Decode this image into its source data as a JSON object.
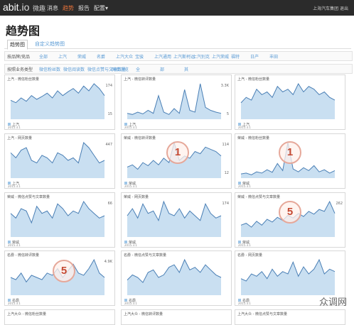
{
  "nav": {
    "logo_main": "abit",
    "logo_io": ".io",
    "logo_sub": "微趣",
    "items": [
      "消息",
      "趋势",
      "报告",
      "配置▾"
    ],
    "right": "上海汽车集团 退出",
    "active_index": 1
  },
  "page": {
    "title": "趋势图"
  },
  "tabs": [
    {
      "label": "趋势图"
    },
    {
      "label": "自定义趋势图"
    }
  ],
  "filter1": {
    "label": "按品牌/竞品",
    "options": [
      "全部",
      "上汽",
      "荣威",
      "名爵",
      "上汽大众",
      "宝骏",
      "上汽通用",
      "上汽斯柯达",
      "上汽别克",
      "上汽荣威",
      "福特",
      "日产",
      "丰田"
    ]
  },
  "filter2": {
    "label": "按照业务类型",
    "options": [
      "微信粉丝数",
      "微信阅读数",
      "微信点赞与文章数量",
      "网页浏览",
      "全",
      "部",
      "其"
    ]
  },
  "cards": [
    {
      "title": "上汽 - 微信粉丝数量",
      "ymax": "174",
      "ymin": "15",
      "legend": "上汽",
      "date": "2015.3.1"
    },
    {
      "title": "上汽 - 微信转评数量",
      "ymax": "3.3K",
      "ymin": "5",
      "legend": "上汽",
      "date": "2015.3.1"
    },
    {
      "title": "上汽 - 微信粉丝数量",
      "ymax": "",
      "ymin": "",
      "legend": "上汽",
      "date": "2015.3.1"
    },
    {
      "title": "上汽 - 网页数量",
      "ymax": "447",
      "ymin": "",
      "legend": "上汽",
      "date": "2015.3.1"
    },
    {
      "title": "荣威 - 微信转评数量",
      "ymax": "114",
      "ymin": "12",
      "legend": "荣威",
      "date": "2015.3.1"
    },
    {
      "title": "荣威 - 微信粉丝数量",
      "ymax": "",
      "ymin": "",
      "legend": "荣威",
      "date": "2015.3.1"
    },
    {
      "title": "荣威 - 微信点赞与文章数量",
      "ymax": "66",
      "ymin": "",
      "legend": "荣威",
      "date": "2015.3.1"
    },
    {
      "title": "荣威 - 网页数量",
      "ymax": "174",
      "ymin": "",
      "legend": "荣威",
      "date": "2015.3.1"
    },
    {
      "title": "荣威 - 微信点赞与文章数量",
      "ymax": "262",
      "ymin": "",
      "legend": "荣威",
      "date": "2015.3.1"
    },
    {
      "title": "名爵 - 微信转评数量",
      "ymax": "4.9K",
      "ymin": "",
      "legend": "名爵",
      "date": "2015.3.1"
    },
    {
      "title": "名爵 - 微信点赞与文章数量",
      "ymax": "",
      "ymin": "",
      "legend": "名爵",
      "date": "2015.3.1"
    },
    {
      "title": "名爵 - 网页数量",
      "ymax": "",
      "ymin": "",
      "legend": "名爵",
      "date": "2015.3.1"
    }
  ],
  "row5": [
    "上汽大众 - 微信粉丝数量",
    "上汽大众 - 微信转评数量",
    "上汽大众 - 微信点赞与文章数量"
  ],
  "badges": [
    {
      "num": "1"
    },
    {
      "num": "1"
    },
    {
      "num": "5"
    },
    {
      "num": "5"
    }
  ],
  "watermark": "众调网",
  "series": [
    [
      40,
      35,
      45,
      38,
      50,
      42,
      48,
      55,
      45,
      60,
      50,
      58,
      65,
      55,
      70,
      60,
      75,
      65,
      50
    ],
    [
      10,
      8,
      12,
      9,
      15,
      10,
      40,
      12,
      8,
      18,
      10,
      50,
      15,
      12,
      60,
      20,
      15,
      12,
      10
    ],
    [
      30,
      40,
      35,
      55,
      45,
      50,
      40,
      60,
      50,
      55,
      45,
      65,
      50,
      60,
      55,
      45,
      50,
      40,
      35
    ],
    [
      50,
      40,
      55,
      60,
      35,
      30,
      45,
      40,
      30,
      50,
      45,
      35,
      40,
      30,
      70,
      60,
      45,
      30,
      35
    ],
    [
      25,
      30,
      20,
      35,
      28,
      40,
      30,
      45,
      35,
      80,
      40,
      50,
      45,
      60,
      55,
      70,
      65,
      60,
      50
    ],
    [
      10,
      12,
      8,
      15,
      12,
      20,
      14,
      35,
      18,
      85,
      22,
      15,
      25,
      18,
      30,
      15,
      20,
      12,
      18
    ],
    [
      50,
      40,
      60,
      55,
      30,
      65,
      50,
      55,
      40,
      70,
      60,
      45,
      55,
      50,
      75,
      60,
      50,
      40,
      45
    ],
    [
      45,
      60,
      40,
      70,
      50,
      55,
      35,
      75,
      50,
      45,
      60,
      40,
      55,
      45,
      35,
      70,
      50,
      40,
      45
    ],
    [
      30,
      35,
      25,
      40,
      30,
      45,
      38,
      50,
      42,
      55,
      48,
      60,
      52,
      65,
      58,
      70,
      65,
      90,
      60
    ],
    [
      40,
      35,
      50,
      30,
      45,
      40,
      35,
      50,
      45,
      60,
      40,
      55,
      70,
      50,
      45,
      60,
      80,
      50,
      40
    ],
    [
      30,
      40,
      35,
      25,
      45,
      50,
      35,
      40,
      55,
      60,
      45,
      70,
      50,
      55,
      45,
      60,
      50,
      40,
      35
    ],
    [
      35,
      30,
      45,
      40,
      50,
      35,
      55,
      40,
      50,
      45,
      70,
      40,
      60,
      45,
      55,
      75,
      45,
      55,
      50
    ]
  ]
}
